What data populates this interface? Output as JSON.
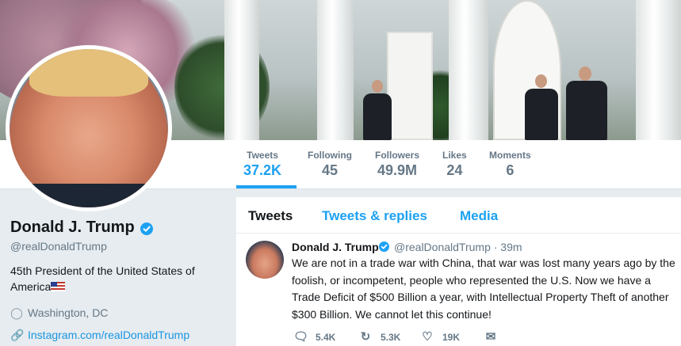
{
  "profile": {
    "name": "Donald J. Trump",
    "handle": "@realDonaldTrump",
    "bio": "45th President of the United States of America",
    "location": "Washington, DC",
    "link": "Instagram.com/realDonaldTrump"
  },
  "stats": [
    {
      "label": "Tweets",
      "value": "37.2K"
    },
    {
      "label": "Following",
      "value": "45"
    },
    {
      "label": "Followers",
      "value": "49.9M"
    },
    {
      "label": "Likes",
      "value": "24"
    },
    {
      "label": "Moments",
      "value": "6"
    }
  ],
  "tabs": [
    {
      "label": "Tweets"
    },
    {
      "label": "Tweets & replies"
    },
    {
      "label": "Media"
    }
  ],
  "tweet": {
    "name": "Donald J. Trump",
    "handle": "@realDonaldTrump · 39m",
    "text": "We are not in a trade war with China, that war was lost many years ago by the foolish, or incompetent, people who represented the U.S. Now we have a Trade Deficit of $500 Billion a year, with Intellectual Property Theft of another $300 Billion. We cannot let this continue!",
    "replies": "5.4K",
    "retweets": "5.3K",
    "likes": "19K"
  },
  "icons": {
    "location": "map-pin-icon",
    "link": "link-icon",
    "reply": "reply-icon",
    "retweet": "retweet-icon",
    "like": "heart-icon",
    "dm": "envelope-icon",
    "verified": "verified-badge-icon"
  },
  "colors": {
    "accent": "#1da1f2",
    "text": "#14171a",
    "muted": "#657786",
    "background": "#e6ecf0"
  }
}
